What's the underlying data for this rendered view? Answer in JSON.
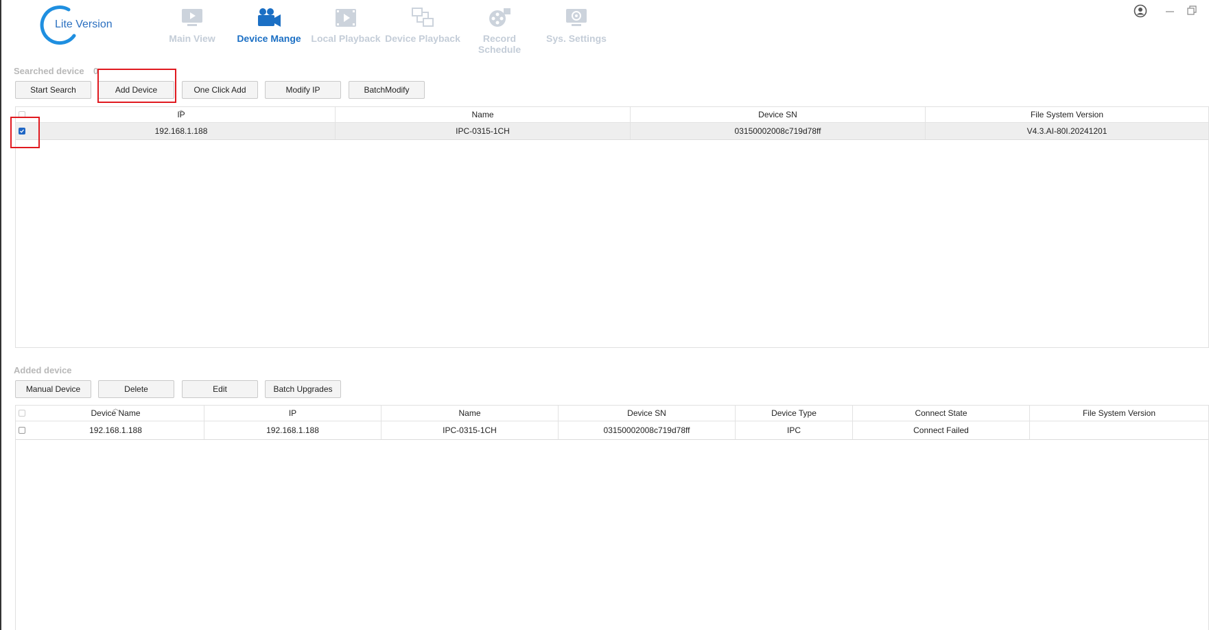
{
  "app": {
    "logo_text": "Lite Version",
    "colors": {
      "accent": "#1b6fc4",
      "highlight": "#e0191f",
      "inactive": "#c4cdd8"
    }
  },
  "nav": {
    "items": [
      {
        "label": "Main View",
        "icon": "monitor-play-icon",
        "active": false
      },
      {
        "label": "Device Mange",
        "icon": "video-camera-icon",
        "active": true
      },
      {
        "label": "Local Playback",
        "icon": "film-play-icon",
        "active": false
      },
      {
        "label": "Device Playback",
        "icon": "devices-icon",
        "active": false
      },
      {
        "label": "Record Schedule",
        "icon": "film-reel-icon",
        "active": false
      },
      {
        "label": "Sys. Settings",
        "icon": "settings-monitor-icon",
        "active": false
      }
    ]
  },
  "window": {
    "user_icon": "user-icon",
    "minimize_icon": "minimize-icon",
    "restore_icon": "restore-icon"
  },
  "searched": {
    "label": "Searched device",
    "count": "0",
    "buttons": [
      "Start Search",
      "Add Device",
      "One Click Add",
      "Modify IP",
      "BatchModify"
    ],
    "columns": [
      "IP",
      "Name",
      "Device SN",
      "File System Version"
    ],
    "rows": [
      {
        "checked": true,
        "ip": "192.168.1.188",
        "name": "IPC-0315-1CH",
        "sn": "03150002008c719d78ff",
        "fs_version": "V4.3.AI-80I.20241201"
      }
    ]
  },
  "added": {
    "label": "Added device",
    "buttons": [
      "Manual Device",
      "Delete",
      "Edit",
      "Batch Upgrades"
    ],
    "columns": [
      "Device Name",
      "IP",
      "Name",
      "Device SN",
      "Device Type",
      "Connect State",
      "File System Version"
    ],
    "rows": [
      {
        "checked": false,
        "device_name": "192.168.1.188",
        "ip": "192.168.1.188",
        "name": "IPC-0315-1CH",
        "sn": "03150002008c719d78ff",
        "type": "IPC",
        "state": "Connect Failed",
        "fs_version": ""
      }
    ]
  }
}
